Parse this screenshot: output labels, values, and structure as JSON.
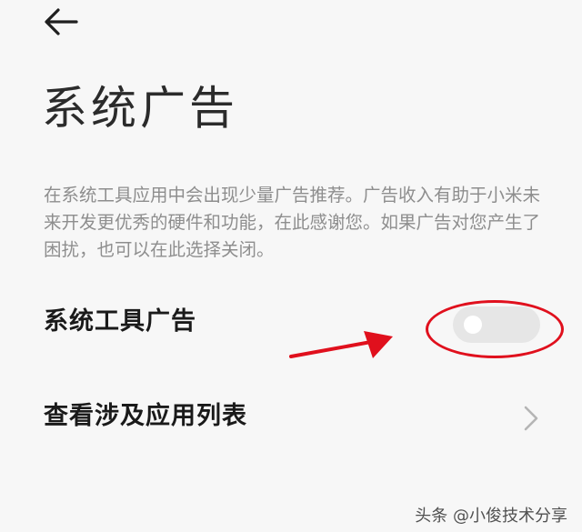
{
  "header": {
    "back_icon": "arrow-left-icon",
    "title": "系统广告"
  },
  "description": "在系统工具应用中会出现少量广告推荐。广告收入有助于小米未来开发更优秀的硬件和功能，在此感谢您。如果广告对您产生了困扰，也可以在此选择关闭。",
  "settings": {
    "ads_toggle": {
      "label": "系统工具广告",
      "state": "off"
    },
    "app_list": {
      "label": "查看涉及应用列表",
      "icon": "chevron-right-icon"
    }
  },
  "annotation": {
    "color": "#e0101d"
  },
  "watermark": "头条 @小俊技术分享"
}
